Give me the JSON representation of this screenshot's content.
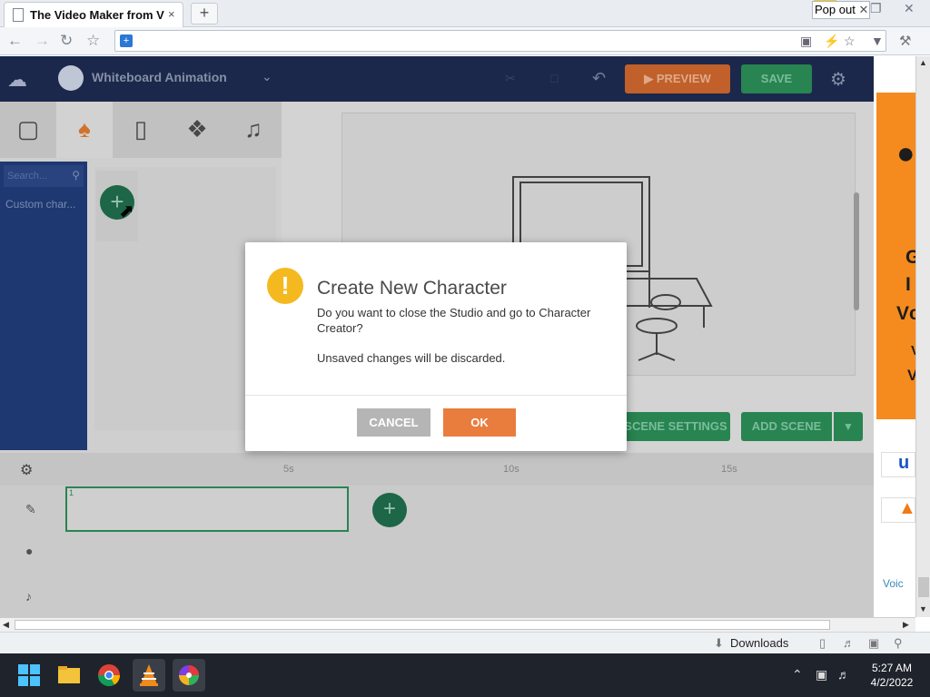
{
  "browser": {
    "tab_title": "The Video Maker from V",
    "tab_close": "×",
    "new_tab": "+",
    "popout_label": "Pop out"
  },
  "app": {
    "title": "Whiteboard Animation",
    "preview_label": "PREVIEW",
    "save_label": "SAVE",
    "library_search_placeholder": "Search...",
    "library_item": "Custom char...",
    "scene_settings_label": "SCENE SETTINGS",
    "add_scene_label": "ADD SCENE",
    "timeline_marks": [
      "5s",
      "10s",
      "15s"
    ]
  },
  "dialog": {
    "title": "Create New Character",
    "message": "Do you want to close the Studio and go to Character Creator?",
    "note": "Unsaved changes will be discarded.",
    "cancel_label": "CANCEL",
    "ok_label": "OK"
  },
  "ad": {
    "letters": [
      "G",
      "I",
      "Vc",
      "V",
      "V"
    ],
    "voice_label": "Voic"
  },
  "statusbar": {
    "downloads_label": "Downloads"
  },
  "taskbar": {
    "time": "5:27 AM",
    "date": "4/2/2022"
  },
  "colors": {
    "preview": "#c9642c",
    "save": "#2a8a55",
    "ok": "#e97d3e",
    "cancel": "#b5b5b5",
    "warning": "#f5b920"
  }
}
